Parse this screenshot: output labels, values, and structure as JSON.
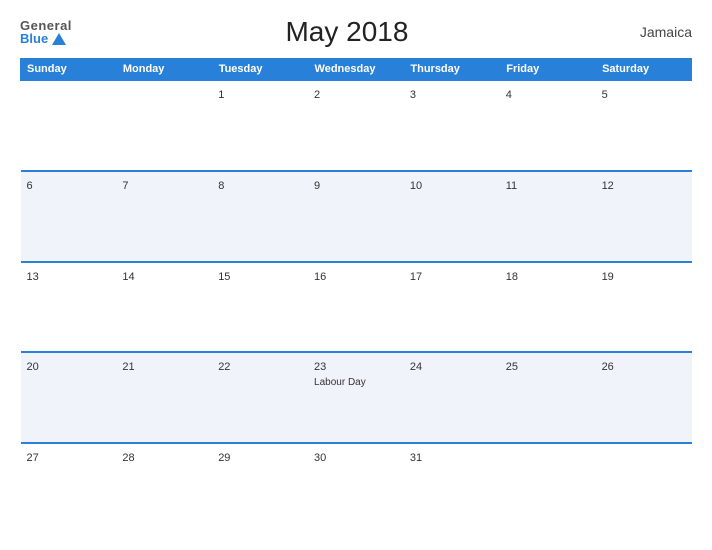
{
  "logo": {
    "general": "General",
    "blue": "Blue"
  },
  "title": "May 2018",
  "country": "Jamaica",
  "weekdays": [
    "Sunday",
    "Monday",
    "Tuesday",
    "Wednesday",
    "Thursday",
    "Friday",
    "Saturday"
  ],
  "weeks": [
    [
      {
        "day": "",
        "event": ""
      },
      {
        "day": "",
        "event": ""
      },
      {
        "day": "1",
        "event": ""
      },
      {
        "day": "2",
        "event": ""
      },
      {
        "day": "3",
        "event": ""
      },
      {
        "day": "4",
        "event": ""
      },
      {
        "day": "5",
        "event": ""
      }
    ],
    [
      {
        "day": "6",
        "event": ""
      },
      {
        "day": "7",
        "event": ""
      },
      {
        "day": "8",
        "event": ""
      },
      {
        "day": "9",
        "event": ""
      },
      {
        "day": "10",
        "event": ""
      },
      {
        "day": "11",
        "event": ""
      },
      {
        "day": "12",
        "event": ""
      }
    ],
    [
      {
        "day": "13",
        "event": ""
      },
      {
        "day": "14",
        "event": ""
      },
      {
        "day": "15",
        "event": ""
      },
      {
        "day": "16",
        "event": ""
      },
      {
        "day": "17",
        "event": ""
      },
      {
        "day": "18",
        "event": ""
      },
      {
        "day": "19",
        "event": ""
      }
    ],
    [
      {
        "day": "20",
        "event": ""
      },
      {
        "day": "21",
        "event": ""
      },
      {
        "day": "22",
        "event": ""
      },
      {
        "day": "23",
        "event": "Labour Day"
      },
      {
        "day": "24",
        "event": ""
      },
      {
        "day": "25",
        "event": ""
      },
      {
        "day": "26",
        "event": ""
      }
    ],
    [
      {
        "day": "27",
        "event": ""
      },
      {
        "day": "28",
        "event": ""
      },
      {
        "day": "29",
        "event": ""
      },
      {
        "day": "30",
        "event": ""
      },
      {
        "day": "31",
        "event": ""
      },
      {
        "day": "",
        "event": ""
      },
      {
        "day": "",
        "event": ""
      }
    ]
  ]
}
